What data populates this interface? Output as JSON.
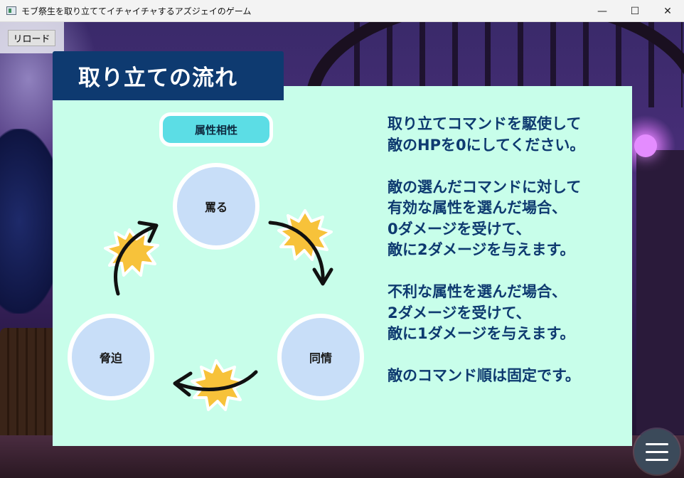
{
  "window": {
    "title": "モブ祭生を取り立ててイチャイチャするアズジェイのゲーム",
    "minimize": "—",
    "maximize": "☐",
    "close": "✕"
  },
  "toolbar": {
    "reload_label": "リロード"
  },
  "panel": {
    "title": "取り立ての流れ",
    "affinity_label": "属性相性",
    "attributes": {
      "top": "罵る",
      "left": "脅迫",
      "right": "同情"
    },
    "rules": [
      "取り立てコマンドを駆使して",
      "敵のHPを0にしてください。",
      "",
      "敵の選んだコマンドに対して",
      "有効な属性を選んだ場合、",
      "0ダメージを受けて、",
      "敵に2ダメージを与えます。",
      "",
      "不利な属性を選んだ場合、",
      "2ダメージを受けて、",
      "敵に1ダメージを与えます。",
      "",
      "敵のコマンド順は固定です。"
    ]
  },
  "colors": {
    "panel_bg": "#c8feea",
    "title_bg": "#0e3a70",
    "text": "#0e3a70",
    "affinity_bg": "#5cdde5",
    "circle_bg": "#c8def8",
    "burst": "#f7c23a"
  },
  "icons": {
    "menu": "hamburger-menu-icon",
    "app": "app-window-icon"
  }
}
